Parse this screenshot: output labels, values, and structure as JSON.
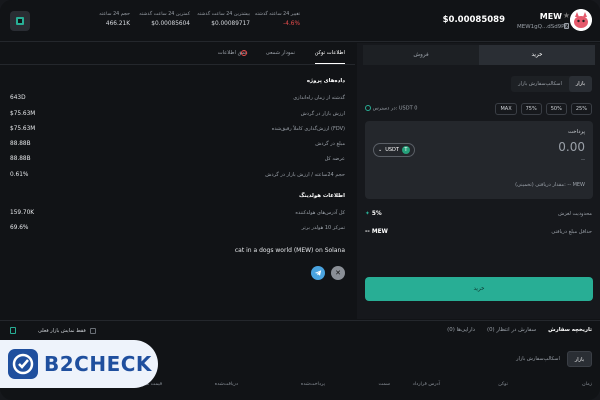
{
  "header": {
    "token_name": "MEW",
    "token_address": "MEW1gQ...dSd9P6",
    "price": "$0.00085089",
    "stats": [
      {
        "label": "تغییر 24 ساعته گذشته",
        "value": "-4.6%"
      },
      {
        "label": "بیشترین 24 ساعت گذشته",
        "value": "$0.00089717"
      },
      {
        "label": "کمترین 24 ساعت گذشته",
        "value": "$0.00085604"
      },
      {
        "label": "حجم 24 ساعته",
        "value": "466.21K"
      }
    ],
    "icons": {
      "logo": "sidebar-toggle-icon",
      "star": "star-icon",
      "copy": "copy-icon",
      "avatar": "token-avatar"
    }
  },
  "left_panel": {
    "tabs": [
      "اطلاعات توکن",
      "نمودار شمعی",
      "عمق اطلاعات"
    ],
    "project_section_title": "داده‌های پروژه",
    "project_rows": [
      {
        "label": "گذشته از زمان راه‌اندازی",
        "value": "643D"
      },
      {
        "label": "ارزش بازار در گردش",
        "value": "$75.63M"
      },
      {
        "label": "ارزش‌گذاری کاملاً رقیق‌شده (FDV)",
        "value": "$75.63M"
      },
      {
        "label": "مبلغ در گردش",
        "value": "88.88B"
      },
      {
        "label": "عرضه کل",
        "value": "88.88B"
      },
      {
        "label": "حجم 24ساعته / ارزش بازار در گردش",
        "value": "0.61%"
      }
    ],
    "holding_section_title": "اطلاعات هولدینگ",
    "holding_rows": [
      {
        "label": "کل آدرس‌های هولدکننده",
        "value": "159.70K"
      },
      {
        "label": "تمرکز 10 هولدر برتر",
        "value": "69.6%"
      }
    ],
    "description": "cat in a dogs world (MEW) on Solana",
    "social": {
      "telegram": "telegram-icon",
      "x": "x-icon"
    }
  },
  "trade_panel": {
    "tabs": {
      "buy": "خرید",
      "sell": "فروش"
    },
    "order_types": [
      "بازار",
      "اسکالپ‌سفارش بازار"
    ],
    "available": "در دسترس: USDT 0",
    "percents": [
      "25%",
      "50%",
      "75%",
      "MAX"
    ],
    "pay_label": "پرداخت",
    "pay_amount": "0.00",
    "pay_sub": "--",
    "currency": "USDT",
    "conversion": "مقدار دریافتی (تخمینی): -- MEW",
    "slippage_label": "محدودیت لغزش",
    "slippage_value": "5%",
    "min_receive_label": "حداقل مبلغ دریافتی",
    "min_receive_value": "-- MEW",
    "buy_button": "خرید"
  },
  "bottom": {
    "tabs": [
      "تاریخچه سفارش",
      "سفارش در انتظار (0)",
      "دارایی‌ها (0)"
    ],
    "hide_small": "فقط نمایش بازار فعلی",
    "order_types": [
      "بازار",
      "اسکالپ‌سفارش بازار"
    ],
    "columns": [
      "زمان",
      "توکن",
      "آدرس قرارداد",
      "سمت",
      "پرداخت‌شده",
      "دریافت‌شده",
      "قیمت میانگین",
      "وضعیت"
    ]
  },
  "watermark": {
    "text": "B2CHECK",
    "icon": "b2check-logo"
  }
}
